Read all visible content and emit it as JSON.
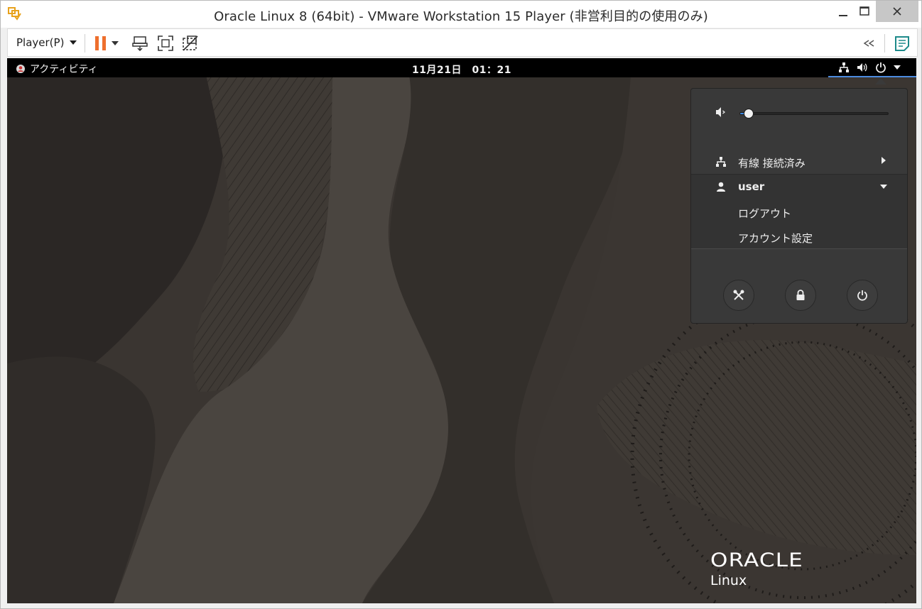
{
  "window": {
    "title": "Oracle Linux 8 (64bit) - VMware Workstation 15 Player (非営利目的の使用のみ)"
  },
  "toolbar": {
    "player_menu": "Player(P)",
    "accent": "#ee6f2d"
  },
  "guest": {
    "topbar": {
      "activities": "アクティビティ",
      "clock": "11月21日　01：21"
    },
    "menu": {
      "volume_level": 0.06,
      "network_label": "有線 接続済み",
      "user_label": "user",
      "logout_label": "ログアウト",
      "account_settings_label": "アカウント設定"
    },
    "logo": {
      "brand": "ORACLE",
      "product": "Linux"
    }
  }
}
